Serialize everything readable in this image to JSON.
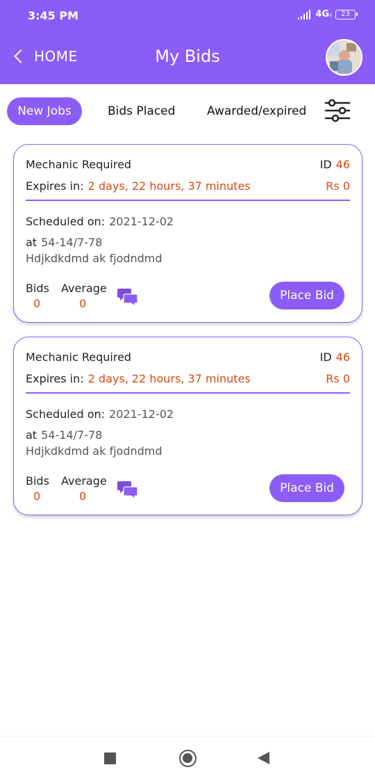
{
  "status_bar": {
    "time": "3:45 PM",
    "network": "4G",
    "network_sub": "ıl",
    "battery": "23"
  },
  "header": {
    "back_label": "HOME",
    "title": "My Bids"
  },
  "tabs": [
    {
      "label": "New Jobs",
      "active": true
    },
    {
      "label": "Bids Placed",
      "active": false
    },
    {
      "label": "Awarded/expired",
      "active": false
    }
  ],
  "cards": [
    {
      "title": "Mechanic Required",
      "id_label": "ID",
      "id_value": "46",
      "expires_label": "Expires in:",
      "expires_value": "2 days, 22 hours, 37 minutes",
      "price": "Rs 0",
      "scheduled_label": "Scheduled on:",
      "scheduled_value": "2021-12-02",
      "at_label": "at",
      "at_value": "54-14/7-78",
      "address": "Hdjkdkdmd ak fjodndmd",
      "bids_label": "Bids",
      "bids_value": "0",
      "average_label": "Average",
      "average_value": "0",
      "button_label": "Place Bid"
    },
    {
      "title": "Mechanic Required",
      "id_label": "ID",
      "id_value": "46",
      "expires_label": "Expires in:",
      "expires_value": "2 days, 22 hours, 37 minutes",
      "price": "Rs 0",
      "scheduled_label": "Scheduled on:",
      "scheduled_value": "2021-12-02",
      "at_label": "at",
      "at_value": "54-14/7-78",
      "address": "Hdjkdkdmd ak fjodndmd",
      "bids_label": "Bids",
      "bids_value": "0",
      "average_label": "Average",
      "average_value": "0",
      "button_label": "Place Bid"
    }
  ],
  "icons": {
    "back": "chevron-left-icon",
    "filter": "sliders-icon",
    "chat": "chat-bubbles-icon",
    "nav_recents": "square-icon",
    "nav_home": "circle-icon",
    "nav_back": "triangle-back-icon"
  },
  "colors": {
    "accent": "#8b5cf6",
    "highlight": "#d9480f",
    "text": "#222222",
    "muted": "#555555"
  }
}
